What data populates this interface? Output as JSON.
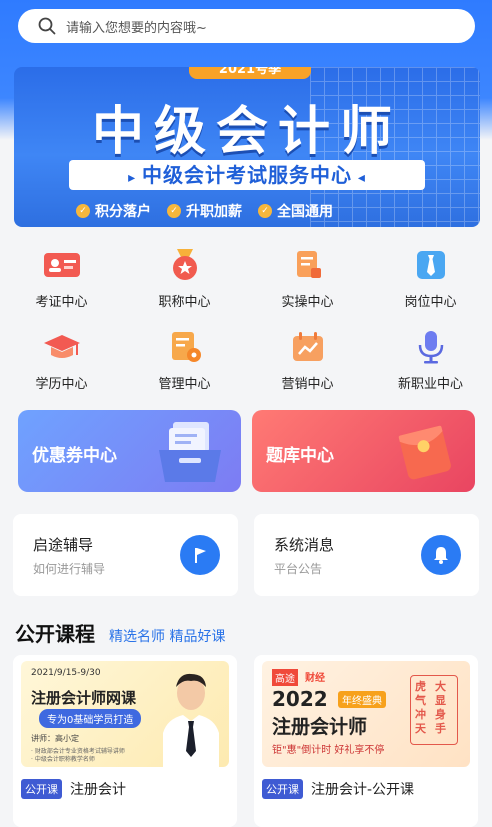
{
  "search": {
    "placeholder": "请输入您想要的内容哦~"
  },
  "banner": {
    "year": "2021号季",
    "title": "中级会计师",
    "subtitle": "中级会计考试服务中心",
    "tags": [
      "积分落户",
      "升职加薪",
      "全国通用"
    ]
  },
  "categories": [
    {
      "label": "考证中心",
      "icon": "id-card-icon"
    },
    {
      "label": "职称中心",
      "icon": "medal-icon"
    },
    {
      "label": "实操中心",
      "icon": "document-icon"
    },
    {
      "label": "岗位中心",
      "icon": "tie-icon"
    },
    {
      "label": "学历中心",
      "icon": "graduation-cap-icon"
    },
    {
      "label": "管理中心",
      "icon": "clipboard-gear-icon"
    },
    {
      "label": "营销中心",
      "icon": "calendar-chart-icon"
    },
    {
      "label": "新职业中心",
      "icon": "microphone-icon"
    }
  ],
  "cards": {
    "coupon": "优惠券中心",
    "bank": "题库中心"
  },
  "info": {
    "guide": {
      "title": "启途辅导",
      "subtitle": "如何进行辅导"
    },
    "notice": {
      "title": "系统消息",
      "subtitle": "平台公告"
    }
  },
  "section": {
    "title": "公开课程",
    "subtitle": "精选名师 精品好课"
  },
  "courses": [
    {
      "badge": "公开课",
      "name": "注册会计",
      "thumb": {
        "date": "2021/9/15-9/30",
        "headline": "注册会计师网课",
        "pill": "专为0基础学员打造",
        "lecturer": "讲师：高小定",
        "line1": "· 财政部会计专业资格考试辅导讲师",
        "line2": "· 中级会计职称教学名师"
      }
    },
    {
      "badge": "公开课",
      "name": "注册会计-公开课",
      "thumb": {
        "brand1": "高途",
        "brand2": "财经",
        "year": "2022",
        "tag": "年终盛典",
        "headline": "注册会计师",
        "footer": "钜\"惠\"倒计时 好礼享不停",
        "v1": "虎气冲天",
        "v2": "大显身手"
      }
    }
  ]
}
